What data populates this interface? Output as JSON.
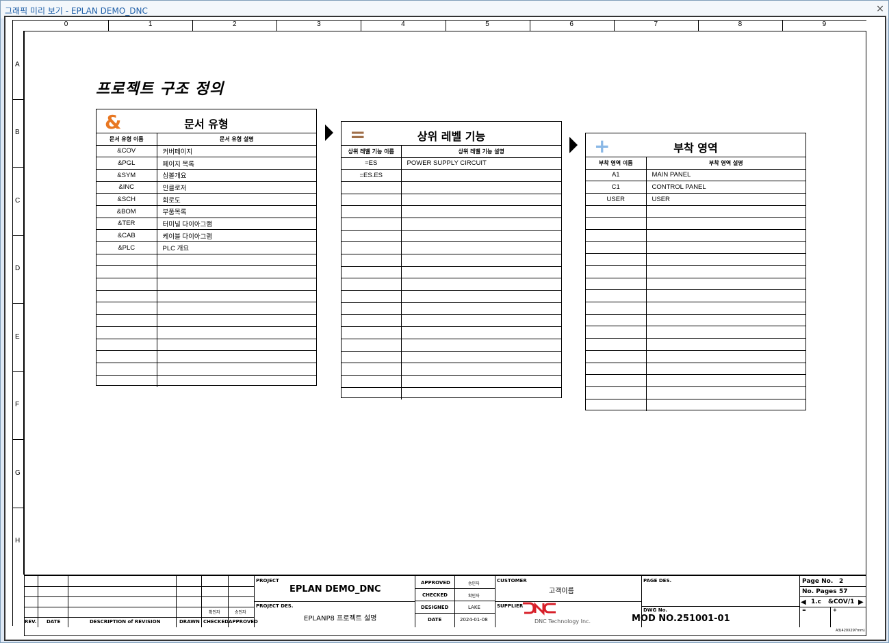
{
  "window": {
    "title": "그래픽 미리 보기 - EPLAN DEMO_DNC",
    "close_glyph": "×"
  },
  "ruler": {
    "columns": [
      "0",
      "1",
      "2",
      "3",
      "4",
      "5",
      "6",
      "7",
      "8",
      "9"
    ],
    "rows": [
      "A",
      "B",
      "C",
      "D",
      "E",
      "F",
      "G",
      "H"
    ]
  },
  "page_title": "프로젝트 구조 정의",
  "panels": {
    "doc_types": {
      "icon": "&",
      "icon_color": "#e87722",
      "title": "문서 유형",
      "col1": "문서 유형 이름",
      "col2": "문서 유형 설명",
      "rows": [
        [
          "&COV",
          "커버페이지"
        ],
        [
          "&PGL",
          "페이지 목록"
        ],
        [
          "&SYM",
          "심볼개요"
        ],
        [
          "&INC",
          "인클로저"
        ],
        [
          "&SCH",
          "회로도"
        ],
        [
          "&BOM",
          "부품목록"
        ],
        [
          "&TER",
          "터미널 다이아그램"
        ],
        [
          "&CAB",
          "케이블 다이아그램"
        ],
        [
          "&PLC",
          "PLC 개요"
        ],
        [
          "",
          ""
        ],
        [
          "",
          ""
        ],
        [
          "",
          ""
        ],
        [
          "",
          ""
        ],
        [
          "",
          ""
        ],
        [
          "",
          ""
        ],
        [
          "",
          ""
        ],
        [
          "",
          ""
        ],
        [
          "",
          ""
        ],
        [
          "",
          ""
        ],
        [
          "",
          ""
        ]
      ]
    },
    "higher_functions": {
      "icon": "=",
      "icon_color": "#a0704a",
      "title": "상위 레벨 기능",
      "col1": "상위 레벨 기능 이름",
      "col2": "상위 레벨 기능 설명",
      "rows": [
        [
          "=ES",
          "POWER SUPPLY CIRCUIT"
        ],
        [
          "=ES.ES",
          ""
        ],
        [
          "",
          ""
        ],
        [
          "",
          ""
        ],
        [
          "",
          ""
        ],
        [
          "",
          ""
        ],
        [
          "",
          ""
        ],
        [
          "",
          ""
        ],
        [
          "",
          ""
        ],
        [
          "",
          ""
        ],
        [
          "",
          ""
        ],
        [
          "",
          ""
        ],
        [
          "",
          ""
        ],
        [
          "",
          ""
        ],
        [
          "",
          ""
        ],
        [
          "",
          ""
        ],
        [
          "",
          ""
        ],
        [
          "",
          ""
        ],
        [
          "",
          ""
        ],
        [
          "",
          ""
        ]
      ]
    },
    "mounting_locations": {
      "icon": "+",
      "icon_color": "#8ab8e6",
      "title": "부착 영역",
      "col1": "부착 영역 이름",
      "col2": "부착 영역 설명",
      "rows": [
        [
          "A1",
          "MAIN PANEL"
        ],
        [
          "C1",
          "CONTROL PANEL"
        ],
        [
          "USER",
          "USER"
        ],
        [
          "",
          ""
        ],
        [
          "",
          ""
        ],
        [
          "",
          ""
        ],
        [
          "",
          ""
        ],
        [
          "",
          ""
        ],
        [
          "",
          ""
        ],
        [
          "",
          ""
        ],
        [
          "",
          ""
        ],
        [
          "",
          ""
        ],
        [
          "",
          ""
        ],
        [
          "",
          ""
        ],
        [
          "",
          ""
        ],
        [
          "",
          ""
        ],
        [
          "",
          ""
        ],
        [
          "",
          ""
        ],
        [
          "",
          ""
        ],
        [
          "",
          ""
        ]
      ]
    }
  },
  "title_block": {
    "rev": "REV.",
    "date": "DATE",
    "description": "DESCRIPTION of REVISION",
    "drawn": "DRAWN",
    "checked": "CHECKED",
    "approved": "APPROVED",
    "checker_kr": "확인자",
    "approver_kr": "승인자",
    "project_label": "PROJECT",
    "project_value": "EPLAN DEMO_DNC",
    "project_des_label": "PROJECT DES.",
    "project_des_value": "EPLANP8 프로젝트 설명",
    "approved_label": "APPROVED",
    "approved_value": "승인자",
    "checked_label": "CHECKED",
    "checked_value": "확인자",
    "designed_label": "DESIGNED",
    "designed_value": "LAKE",
    "date_label": "DATE",
    "date_value": "2024-01-08",
    "customer_label": "CUSTOMER",
    "customer_value": "고객이름",
    "supplier_label": "SUPPLIER",
    "supplier_value": "DNC Technology Inc.",
    "page_des_label": "PAGE DES.",
    "dwg_label": "DWG No.",
    "dwg_value": "MOD NO.251001-01",
    "page_no_label": "Page No.",
    "page_no_value": "2",
    "no_pages_label": "No. Pages",
    "no_pages_value": "57",
    "page_id_left": "1.c",
    "page_id_right": "&COV/1",
    "eq": "=",
    "plus": "+",
    "format": "A3(420X297mm)",
    "logo_color": "#d8202a"
  }
}
